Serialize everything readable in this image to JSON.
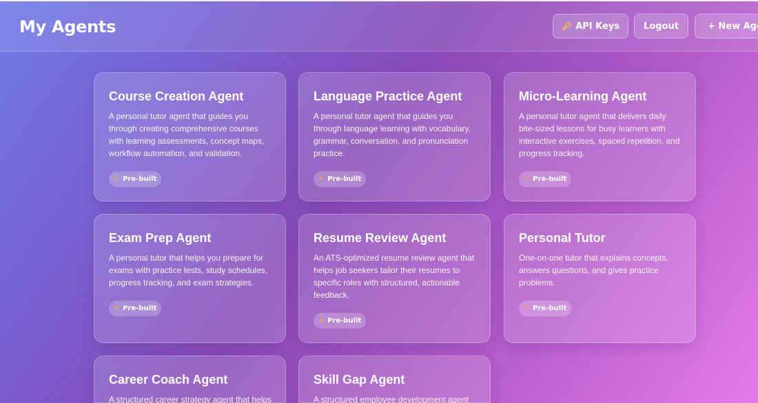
{
  "header": {
    "title": "My Agents",
    "api_keys_label": "API Keys",
    "logout_label": "Logout",
    "new_agent_label": "+ New Agent"
  },
  "badge_label": "Pre-built",
  "agents": [
    {
      "title": "Course Creation Agent",
      "description": "A personal tutor agent that guides you through creating comprehensive courses with learning assessments, concept maps, workflow automation, and validation."
    },
    {
      "title": "Language Practice Agent",
      "description": "A personal tutor agent that guides you through language learning with vocabulary, grammar, conversation, and pronunciation practice."
    },
    {
      "title": "Micro-Learning Agent",
      "description": "A personal tutor agent that delivers daily bite-sized lessons for busy learners with interactive exercises, spaced repetition, and progress tracking."
    },
    {
      "title": "Exam Prep Agent",
      "description": "A personal tutor that helps you prepare for exams with practice tests, study schedules, progress tracking, and exam strategies."
    },
    {
      "title": "Resume Review Agent",
      "description": "An ATS-optimized resume review agent that helps job seekers tailor their resumes to specific roles with structured, actionable feedback."
    },
    {
      "title": "Personal Tutor",
      "description": "One-on-one tutor that explains concepts, answers questions, and gives practice problems."
    },
    {
      "title": "Career Coach Agent",
      "description": "A structured career strategy agent that helps"
    },
    {
      "title": "Skill Gap Agent",
      "description": "A structured employee development agent"
    }
  ],
  "colors": {
    "gradient_start": "#6f7be6",
    "gradient_end": "#e47be8",
    "key_icon": "#f4c542",
    "badge_icon": "#f2a541"
  },
  "icons": {
    "api_keys": "key-icon",
    "badge": "sparkle-icon"
  }
}
